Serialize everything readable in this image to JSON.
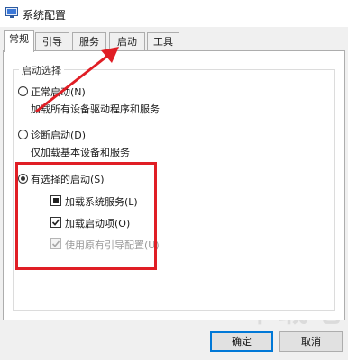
{
  "window": {
    "title": "系统配置",
    "icon": "system-config-icon"
  },
  "tabs": [
    {
      "label": "常规",
      "active": true
    },
    {
      "label": "引导",
      "active": false
    },
    {
      "label": "服务",
      "active": false
    },
    {
      "label": "启动",
      "active": false
    },
    {
      "label": "工具",
      "active": false
    }
  ],
  "startup_group": {
    "legend": "启动选择",
    "normal": {
      "label": "正常启动(N)",
      "desc": "加载所有设备驱动程序和服务",
      "checked": false
    },
    "diagnostic": {
      "label": "诊断启动(D)",
      "desc": "仅加载基本设备和服务",
      "checked": false
    },
    "selective": {
      "label": "有选择的启动(S)",
      "checked": true,
      "load_system_services": {
        "label": "加载系统服务(L)",
        "state": "indeterminate"
      },
      "load_startup_items": {
        "label": "加载启动项(O)",
        "state": "checked"
      },
      "use_original_boot": {
        "label": "使用原有引导配置(U)",
        "state": "checked-disabled"
      }
    }
  },
  "buttons": {
    "ok": "确定",
    "cancel": "取消"
  },
  "annotations": {
    "highlight_color": "#e01e25",
    "arrow_color": "#e01e25",
    "arrow_target": "启动"
  },
  "watermark": "下载吧"
}
